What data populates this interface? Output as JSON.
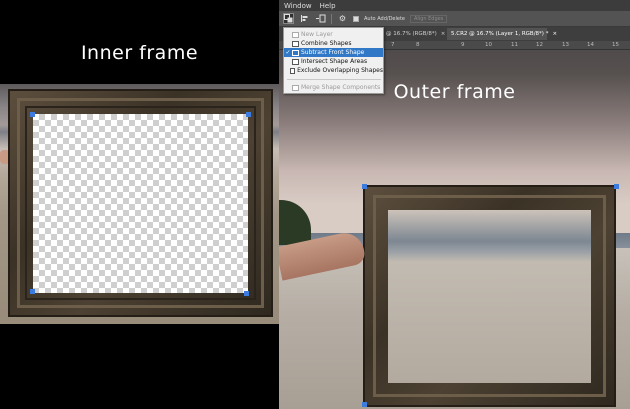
{
  "left_panel": {
    "title": "Inner frame"
  },
  "right_panel": {
    "title": "Outer frame"
  },
  "menubar": {
    "items": [
      "Window",
      "Help"
    ]
  },
  "options_bar": {
    "auto_add_delete_label": "Auto Add/Delete",
    "auto_add_delete_checked": true,
    "align_edges_label": "Align Edges"
  },
  "tabs": [
    {
      "label": "@ 16.7% (RGB/8*)",
      "close": "×"
    },
    {
      "label": "5.CR2 @ 16.7% (Layer 1, RGB/8*) *",
      "close": "×"
    }
  ],
  "ruler": {
    "numbers": [
      "7",
      "8",
      "9",
      "10",
      "11",
      "12",
      "13",
      "14",
      "15"
    ]
  },
  "dropdown": {
    "items": [
      {
        "label": "New Layer",
        "state": "disabled",
        "check": ""
      },
      {
        "label": "Combine Shapes",
        "state": "normal",
        "check": ""
      },
      {
        "label": "Subtract Front Shape",
        "state": "selected",
        "check": "✓"
      },
      {
        "label": "Intersect Shape Areas",
        "state": "normal",
        "check": ""
      },
      {
        "label": "Exclude Overlapping Shapes",
        "state": "normal",
        "check": ""
      },
      {
        "label": "Merge Shape Components",
        "state": "disabled",
        "check": ""
      }
    ]
  },
  "colors": {
    "selection": "#3178c6",
    "anchor": "#3c7be0",
    "ps_panel": "#535353"
  }
}
